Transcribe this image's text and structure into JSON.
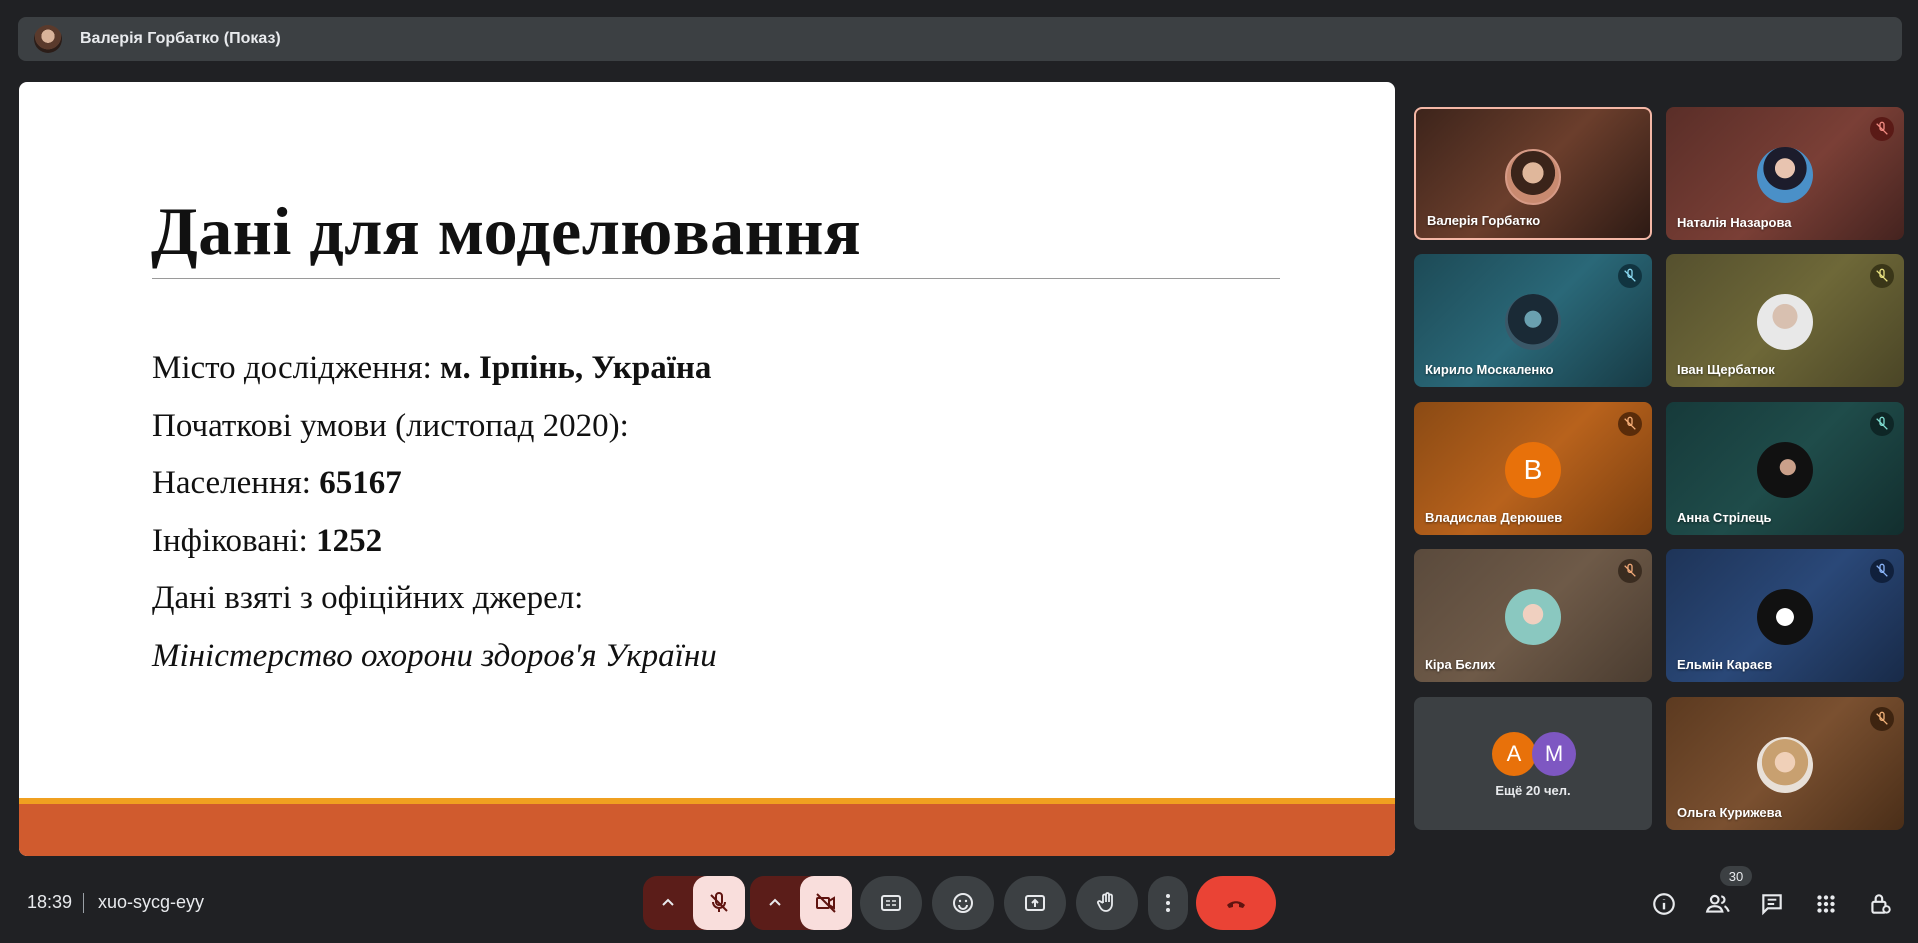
{
  "presenter_bar": {
    "title": "Валерія Горбатко (Показ)"
  },
  "slide": {
    "heading": "Дані для моделювання",
    "line1_label": "Місто дослідження: ",
    "line1_value": "м. Ірпінь, Україна",
    "line2": "Початкові умови (листопад 2020):",
    "line3_label": "Населення: ",
    "line3_value": "65167",
    "line4_label": "Інфіковані: ",
    "line4_value": "1252",
    "line5": "Дані взяті з офіційних джерел:",
    "line6": "Міністерство охорони здоров'я України"
  },
  "participants": [
    {
      "name": "Валерія Горбатко",
      "speaking": true,
      "muted": false
    },
    {
      "name": "Наталія Назарова",
      "muted": true
    },
    {
      "name": "Кирило Москаленко",
      "muted": true
    },
    {
      "name": "Іван Щербатюк",
      "muted": true
    },
    {
      "name": "Владислав Дерюшев",
      "initial": "В",
      "muted": true
    },
    {
      "name": "Анна Стрілець",
      "muted": true
    },
    {
      "name": "Кіра Бєлих",
      "muted": true
    },
    {
      "name": "Ельмін Караєв",
      "muted": true
    },
    {
      "name": "Ольга Курижева",
      "muted": true
    }
  ],
  "more_tile": {
    "label": "Ещё 20 чел.",
    "initials": [
      "А",
      "М"
    ]
  },
  "bottom_bar": {
    "time": "18:39",
    "meeting_code": "xuo-sycg-eyy",
    "participant_count": "30"
  },
  "colors": {
    "background": "#202124",
    "tile_dark": "#3c4043",
    "hangup": "#ea4335",
    "slide_band": "#d05b2e",
    "slide_band_top": "#f0a020",
    "muted_control": "#f9dedc"
  }
}
